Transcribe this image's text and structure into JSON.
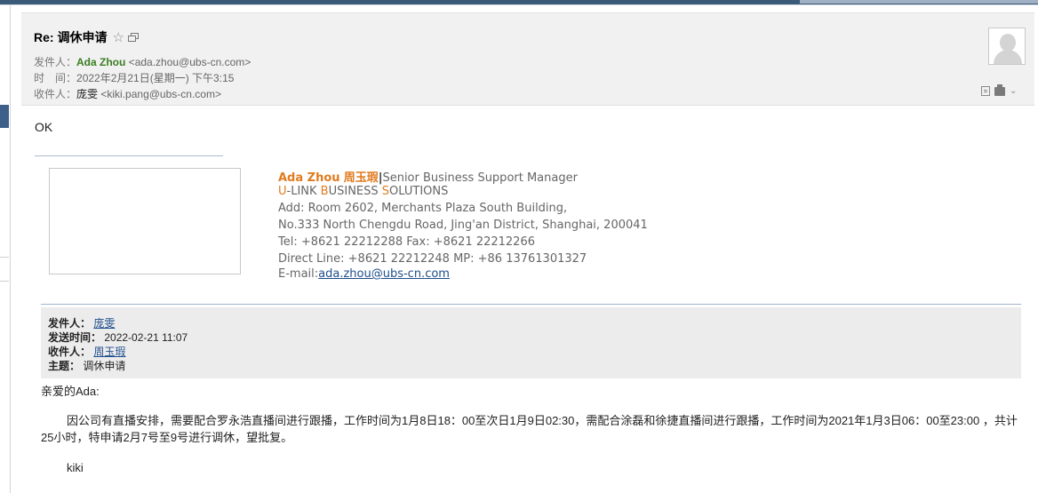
{
  "header": {
    "subject": "Re: 调休申请",
    "sender_label": "发件人：",
    "sender_name": "Ada Zhou",
    "sender_email": "<ada.zhou@ubs-cn.com>",
    "time_label": "时　间：",
    "time_value": "2022年2月21日(星期一) 下午3:15",
    "recipient_label": "收件人：",
    "recipient_name": "庞雯",
    "recipient_email": "<kiki.pang@ubs-cn.com>",
    "icons": [
      "star-icon",
      "popout-icon",
      "avatar",
      "note-icon",
      "print-icon",
      "chevron-down-icon"
    ]
  },
  "body": {
    "reply_text": "OK"
  },
  "signature": {
    "name_en": "Ada Zhou",
    "name_cn": "周玉瑕",
    "separator": "|",
    "title": "Senior Business Support Manager",
    "company_u": "U",
    "company_1": "-LINK ",
    "company_b": "B",
    "company_2": "USINESS ",
    "company_s": "S",
    "company_3": "OLUTIONS",
    "address1": "Add: Room 2602, Merchants Plaza South Building,",
    "address2": "No.333 North Chengdu Road, Jing'an District, Shanghai, 200041",
    "tel": "Tel: +8621 22212288  Fax: +8621 22212266",
    "direct": "Direct Line: +8621 22212248   MP: +86 13761301327",
    "email_label": "E-mail:",
    "email": "ada.zhou@ubs-cn.com",
    "colors": {
      "accent": "#e07b1f",
      "link": "#1f4e8c"
    }
  },
  "quoted": {
    "from_label": "发件人：",
    "from_value": "庞雯",
    "sent_label": "发送时间：",
    "sent_value": "2022-02-21 11:07",
    "to_label": "收件人：",
    "to_value": "周玉瑕",
    "subject_label": "主题：",
    "subject_value": "调休申请",
    "greeting": "亲爱的Ada:",
    "paragraph": "因公司有直播安排，需要配合罗永浩直播间进行跟播，工作时间为1月8日18：00至次日1月9日02:30，需配合涂磊和徐捷直播间进行跟播，工作时间为2021年1月3日06：00至23:00 ，共计25小时，特申请2月7号至9号进行调休，望批复。",
    "sign": "kiki"
  }
}
